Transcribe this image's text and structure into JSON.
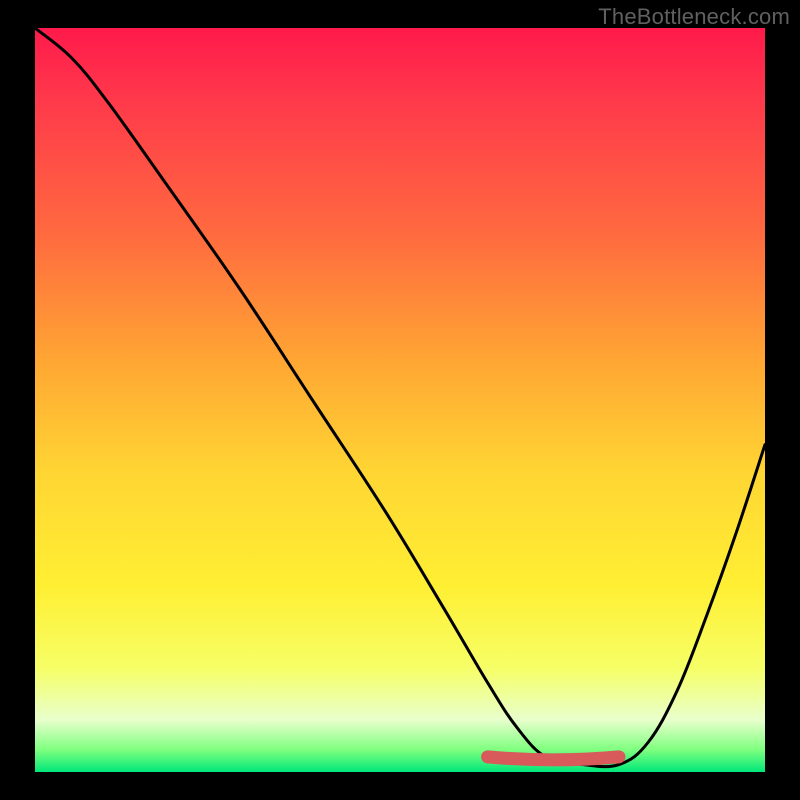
{
  "watermark": "TheBottleneck.com",
  "chart_data": {
    "type": "line",
    "title": "",
    "xlabel": "",
    "ylabel": "",
    "xlim": [
      0,
      100
    ],
    "ylim": [
      0,
      100
    ],
    "gradient_stops": [
      {
        "pos": 0,
        "color": "#ff1a4b"
      },
      {
        "pos": 10,
        "color": "#ff3a4b"
      },
      {
        "pos": 28,
        "color": "#ff6b3f"
      },
      {
        "pos": 45,
        "color": "#ffa733"
      },
      {
        "pos": 60,
        "color": "#ffd633"
      },
      {
        "pos": 75,
        "color": "#ffef33"
      },
      {
        "pos": 86,
        "color": "#f6ff66"
      },
      {
        "pos": 93,
        "color": "#e8ffcc"
      },
      {
        "pos": 97,
        "color": "#7fff7f"
      },
      {
        "pos": 100,
        "color": "#00e87a"
      }
    ],
    "series": [
      {
        "name": "curve",
        "x": [
          0,
          5,
          10,
          18,
          28,
          38,
          48,
          56,
          62,
          66,
          70,
          75,
          80,
          84,
          88,
          92,
          96,
          100
        ],
        "y": [
          100,
          96,
          90,
          79,
          65,
          50,
          35,
          22,
          12,
          6,
          2,
          1,
          1,
          4,
          11,
          21,
          32,
          44
        ]
      }
    ],
    "highlight_segment": {
      "name": "trough",
      "x_start": 62,
      "x_end": 80,
      "y": 1.5,
      "color": "#d85a5a"
    }
  }
}
